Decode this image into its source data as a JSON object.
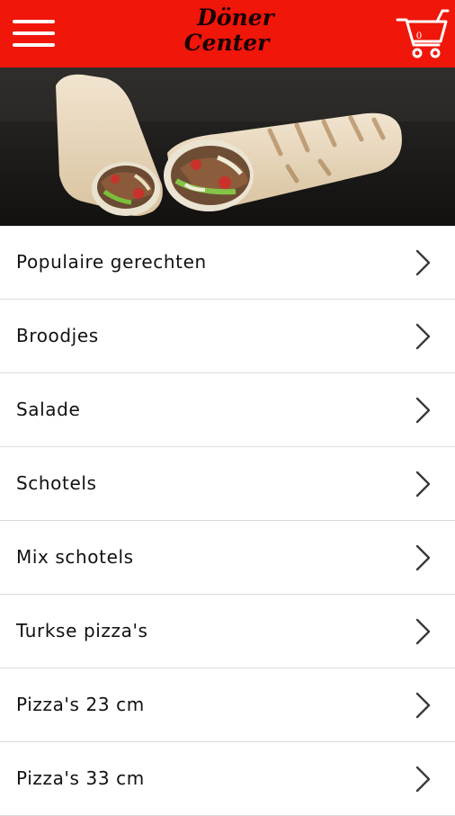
{
  "header": {
    "logo_line1": "Döner",
    "logo_line2": "Center",
    "cart_count": "0"
  },
  "colors": {
    "brand_red": "#f0160a",
    "text": "#111111",
    "divider": "#dcdcdc"
  },
  "icons": {
    "menu": "hamburger-menu-icon",
    "cart": "shopping-cart-icon",
    "row": "chevron-right-icon"
  },
  "categories": [
    {
      "label": "Populaire gerechten"
    },
    {
      "label": "Broodjes"
    },
    {
      "label": "Salade"
    },
    {
      "label": "Schotels"
    },
    {
      "label": "Mix schotels"
    },
    {
      "label": "Turkse pizza's"
    },
    {
      "label": "Pizza's 23 cm"
    },
    {
      "label": "Pizza's 33 cm"
    }
  ]
}
